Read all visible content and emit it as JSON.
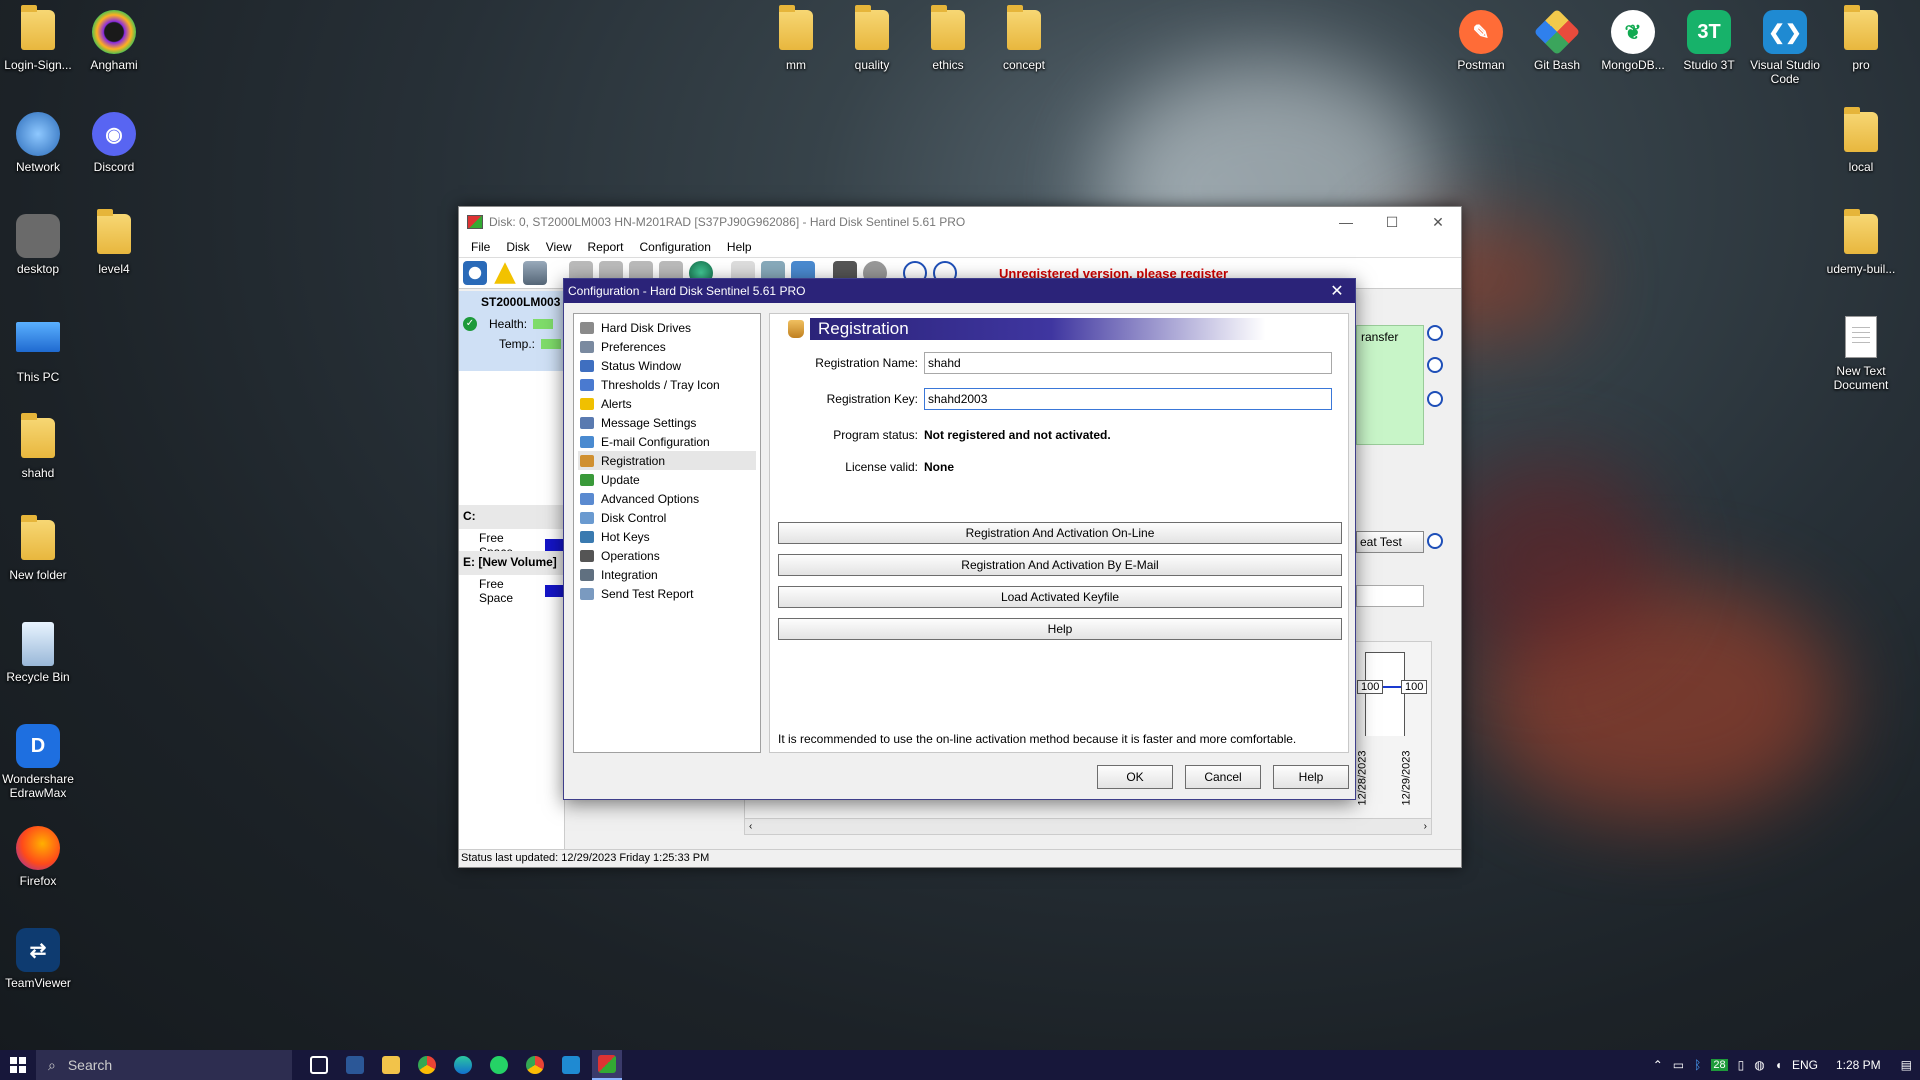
{
  "desktop": {
    "left_icons": [
      {
        "label": "Login-Sign...",
        "type": "folder"
      },
      {
        "label": "Network",
        "type": "app"
      },
      {
        "label": "desktop",
        "type": "app"
      },
      {
        "label": "This PC",
        "type": "app"
      },
      {
        "label": "shahd",
        "type": "folder"
      },
      {
        "label": "New folder",
        "type": "folder"
      },
      {
        "label": "Recycle Bin",
        "type": "app"
      },
      {
        "label": "Wondershare EdrawMax",
        "type": "app"
      },
      {
        "label": "Firefox",
        "type": "app"
      },
      {
        "label": "TeamViewer",
        "type": "app"
      }
    ],
    "col2_icons": [
      {
        "label": "Anghami"
      },
      {
        "label": "Discord"
      },
      {
        "label": "level4"
      }
    ],
    "top_folders": [
      {
        "label": "mm"
      },
      {
        "label": "quality"
      },
      {
        "label": "ethics"
      },
      {
        "label": "concept"
      }
    ],
    "right_apps": [
      {
        "label": "Postman"
      },
      {
        "label": "Git Bash"
      },
      {
        "label": "MongoDB..."
      },
      {
        "label": "Studio 3T"
      },
      {
        "label": "Visual Studio Code"
      },
      {
        "label": "pro"
      }
    ],
    "right_col": [
      {
        "label": "local"
      },
      {
        "label": "udemy-buil..."
      },
      {
        "label": "New Text Document"
      }
    ]
  },
  "main_window": {
    "title": "Disk: 0, ST2000LM003 HN-M201RAD [S37PJ90G962086]  -  Hard Disk Sentinel 5.61 PRO",
    "menu": [
      "File",
      "Disk",
      "View",
      "Report",
      "Configuration",
      "Help"
    ],
    "unregistered_text": "Unregistered version, please register",
    "disk_name": "ST2000LM003",
    "health_label": "Health:",
    "temp_label": "Temp.:",
    "drive_c": "C:",
    "drive_e": "E: [New Volume]",
    "free_space_label": "Free Space",
    "status_bar": "Status last updated: 12/29/2023 Friday 1:25:33 PM",
    "side_transfer": "ransfer",
    "side_test": "eat Test",
    "graph_values": [
      "100",
      "100"
    ],
    "graph_dates": [
      "12/28/2023",
      "12/29/2023"
    ]
  },
  "dialog": {
    "title": "Configuration  -  Hard Disk Sentinel 5.61 PRO",
    "tree": [
      {
        "label": "Hard Disk Drives",
        "color": "#8a8a8a"
      },
      {
        "label": "Preferences",
        "color": "#7a8aa0"
      },
      {
        "label": "Status Window",
        "color": "#3f6fc0"
      },
      {
        "label": "Thresholds / Tray Icon",
        "color": "#4a7ad0"
      },
      {
        "label": "Alerts",
        "color": "#f0c000"
      },
      {
        "label": "Message Settings",
        "color": "#5a7ab0"
      },
      {
        "label": "E-mail Configuration",
        "color": "#4a8ad0"
      },
      {
        "label": "Registration",
        "color": "#d09030"
      },
      {
        "label": "Update",
        "color": "#3a9a3a"
      },
      {
        "label": "Advanced Options",
        "color": "#5a8ad0"
      },
      {
        "label": "Disk Control",
        "color": "#6a9ad0"
      },
      {
        "label": "Hot Keys",
        "color": "#3a7ab0"
      },
      {
        "label": "Operations",
        "color": "#555555"
      },
      {
        "label": "Integration",
        "color": "#607080"
      },
      {
        "label": "Send Test Report",
        "color": "#7a9ac0"
      }
    ],
    "selected_item": "Registration",
    "heading": "Registration",
    "fields": {
      "name_label": "Registration Name:",
      "name_value": "shahd",
      "key_label": "Registration Key:",
      "key_value": "shahd2003",
      "status_label": "Program status:",
      "status_value": "Not registered and not activated.",
      "license_label": "License valid:",
      "license_value": "None"
    },
    "buttons": {
      "online": "Registration And Activation On-Line",
      "email": "Registration And Activation By E-Mail",
      "keyfile": "Load Activated Keyfile",
      "help": "Help"
    },
    "recommendation": "It is recommended to use the on-line activation method because it is faster and more comfortable.",
    "ok": "OK",
    "cancel": "Cancel",
    "help_btn": "Help"
  },
  "taskbar": {
    "search_placeholder": "Search",
    "language": "ENG",
    "time": "1:28 PM",
    "tray_badge": "28"
  }
}
